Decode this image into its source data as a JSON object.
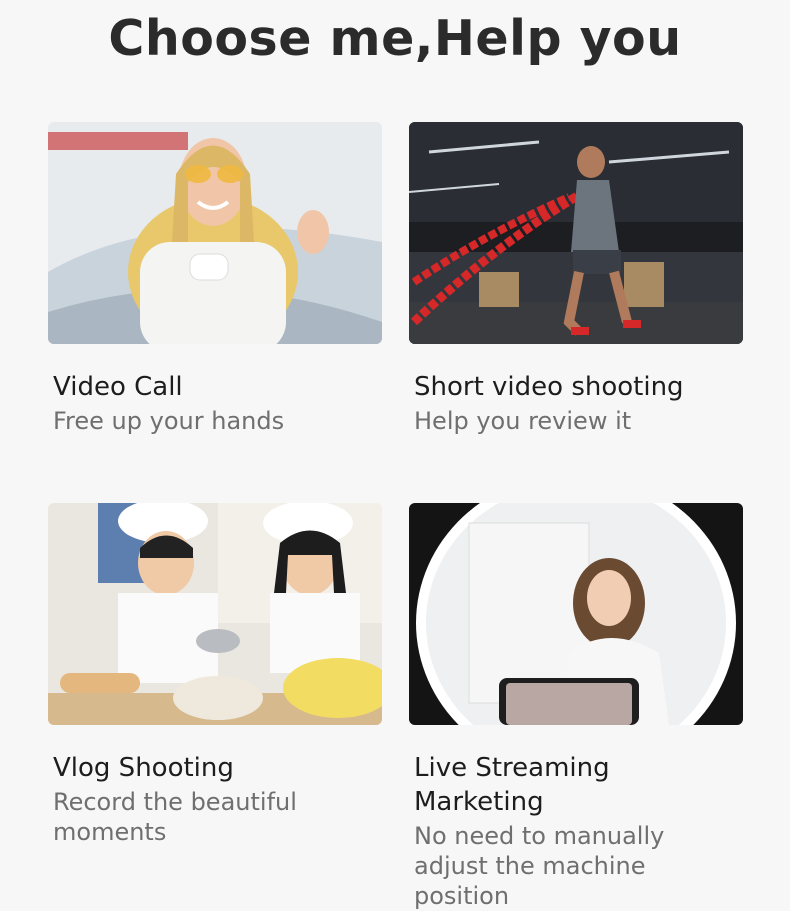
{
  "header": {
    "title": "Choose me,Help you"
  },
  "cards": [
    {
      "title": "Video Call",
      "subtitle": "Free up your hands",
      "image": "woman-with-sunglasses-video-call-photo"
    },
    {
      "title": "Short video shooting",
      "subtitle": "Help you review it",
      "image": "man-with-battle-ropes-gym-photo"
    },
    {
      "title": "Vlog Shooting",
      "subtitle": "Record the beautiful moments",
      "image": "children-baking-in-chef-hats-photo"
    },
    {
      "title": "Live Streaming Marketing",
      "subtitle": "No need to manually adjust the machine position",
      "image": "woman-streaming-with-ring-light-photo"
    }
  ]
}
